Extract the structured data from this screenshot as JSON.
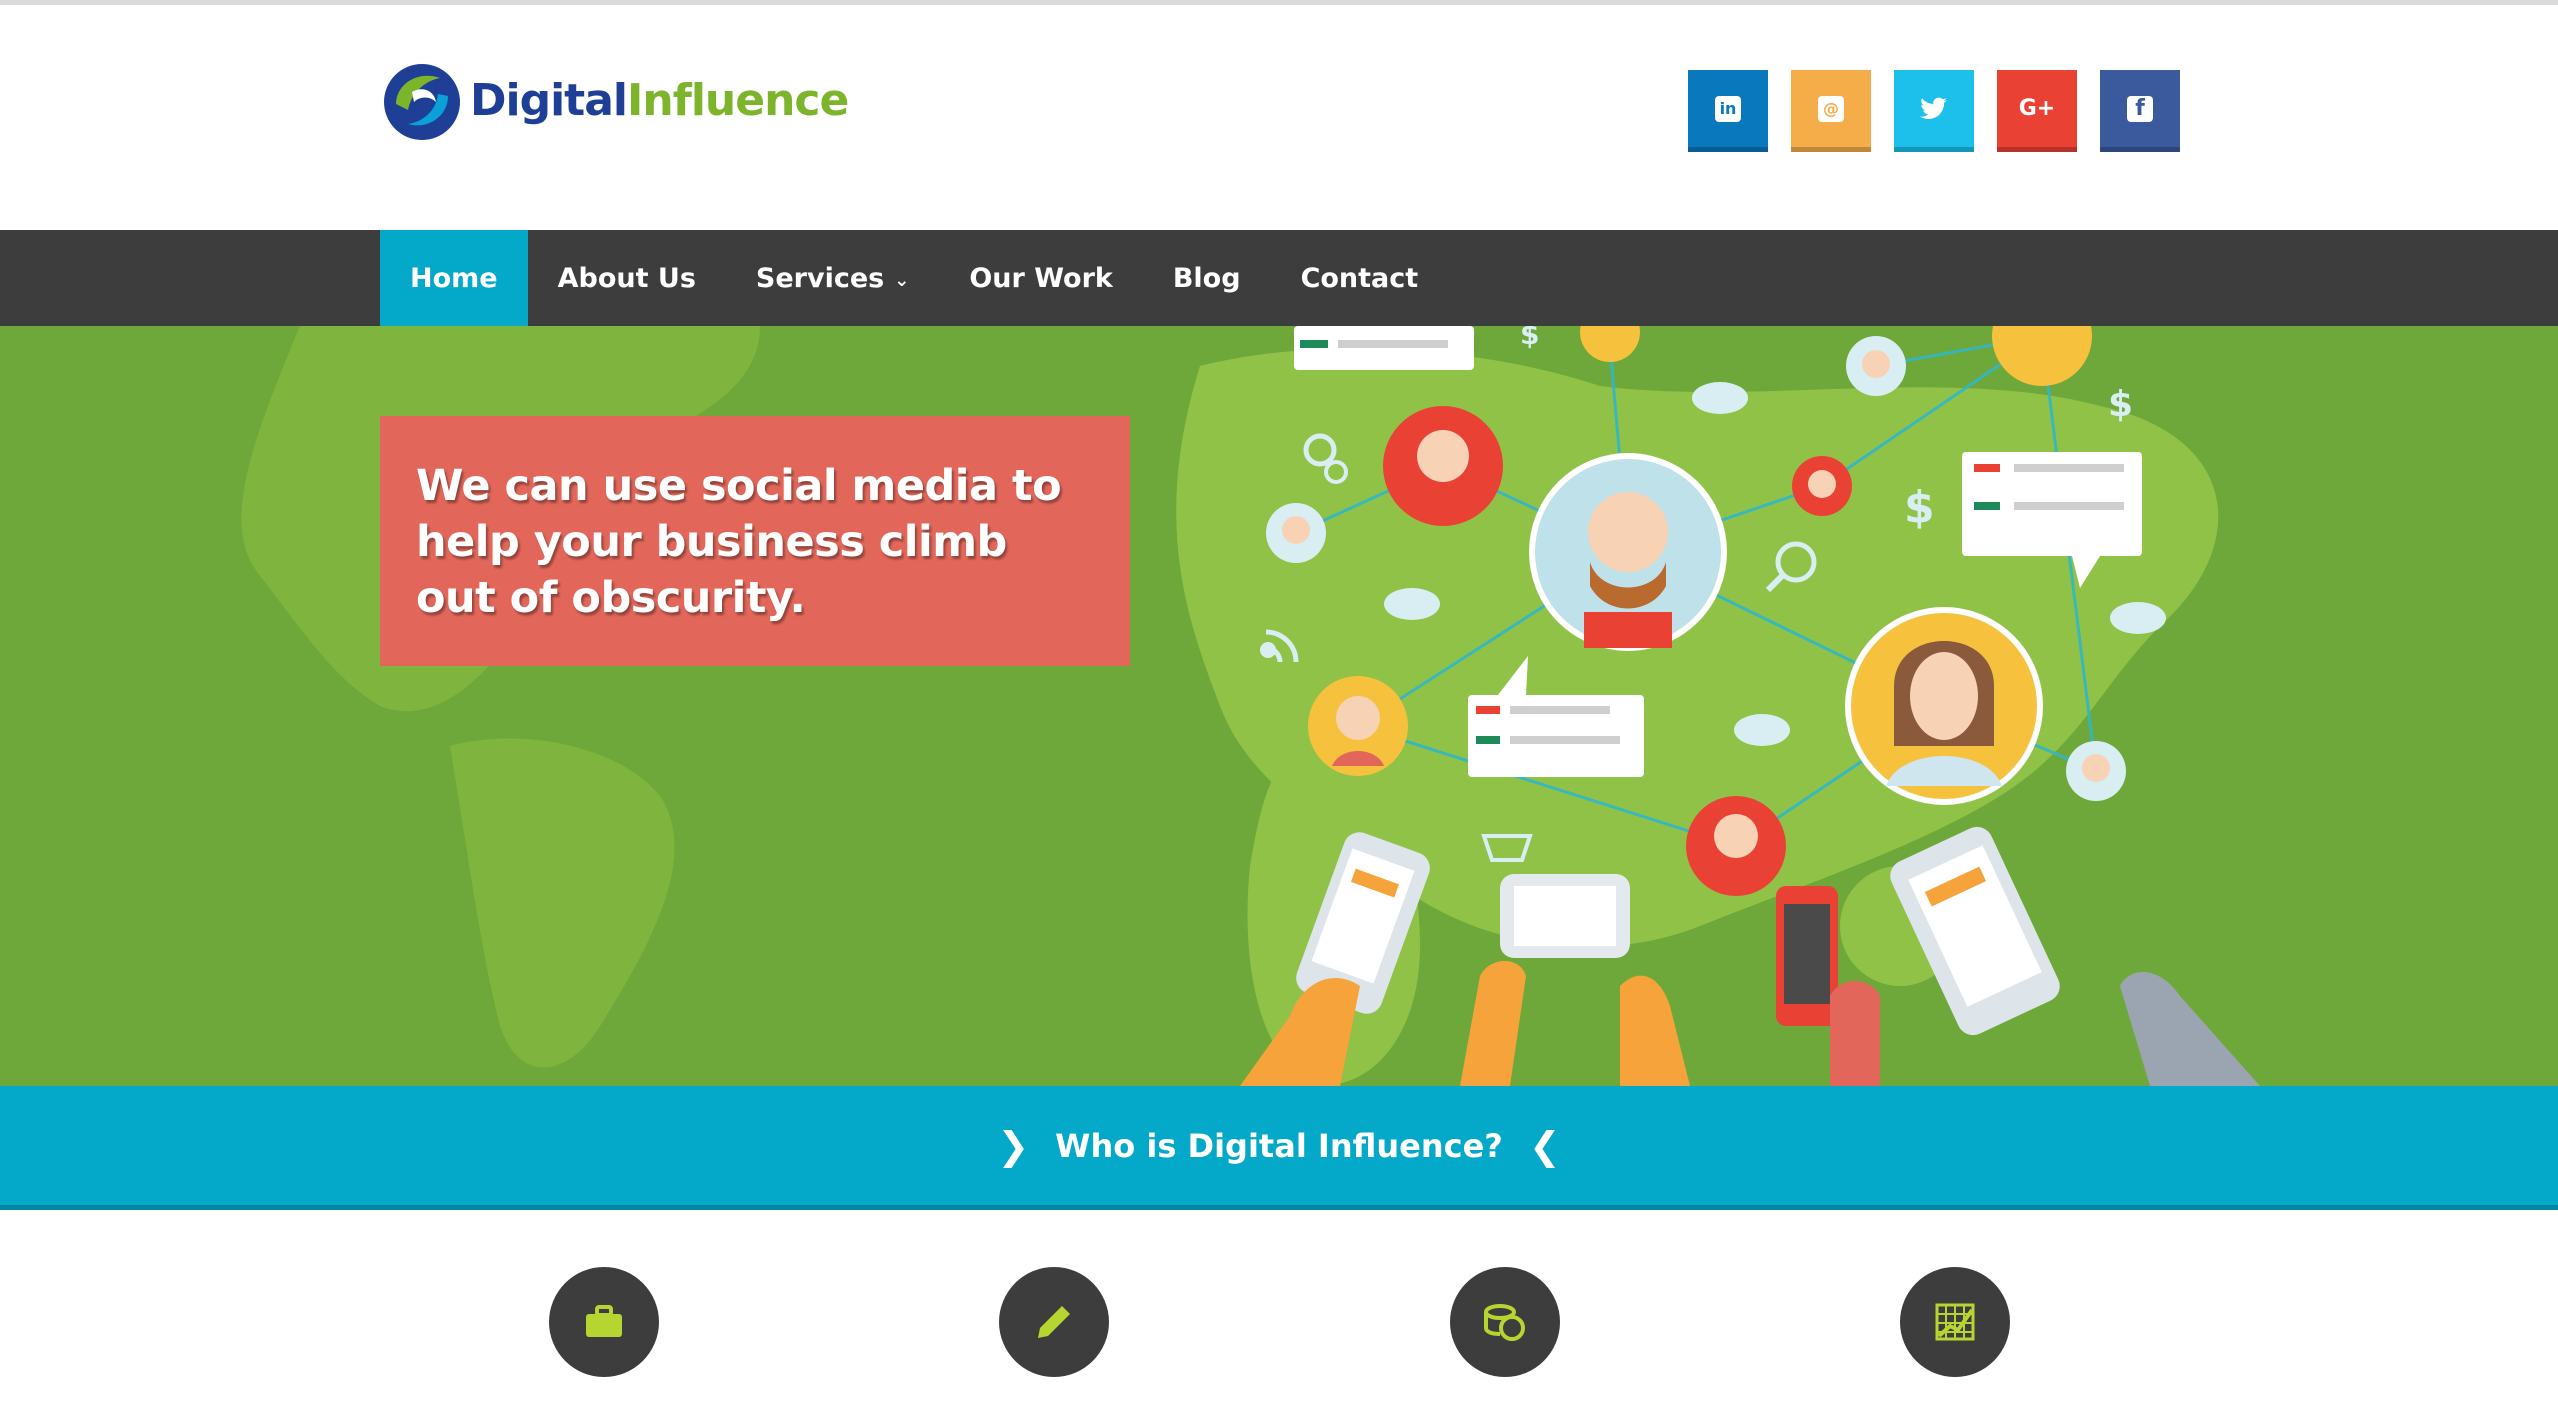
{
  "brand": {
    "name_part1": "Digital",
    "name_part2": "Influence"
  },
  "social": [
    {
      "name": "linkedin",
      "glyph": "in",
      "color": "#0a78bd"
    },
    {
      "name": "email",
      "glyph": "@",
      "color": "#f4ad49"
    },
    {
      "name": "twitter",
      "glyph": "🐦",
      "color": "#1dc0ea"
    },
    {
      "name": "googleplus",
      "glyph": "G+",
      "color": "#e94235"
    },
    {
      "name": "facebook",
      "glyph": "f",
      "color": "#3b5a9d"
    }
  ],
  "nav": {
    "items": [
      {
        "label": "Home",
        "active": true
      },
      {
        "label": "About Us"
      },
      {
        "label": "Services",
        "has_dropdown": true
      },
      {
        "label": "Our Work"
      },
      {
        "label": "Blog"
      },
      {
        "label": "Contact"
      }
    ]
  },
  "hero": {
    "headline": "We can use social media to help your business climb out of obscurity."
  },
  "band": {
    "text": "Who is Digital Influence?"
  },
  "services": [
    {
      "icon": "briefcase-icon"
    },
    {
      "icon": "pencil-icon"
    },
    {
      "icon": "coins-icon"
    },
    {
      "icon": "chart-icon"
    }
  ],
  "colors": {
    "nav_bg": "#3d3d3d",
    "accent": "#04a8c8",
    "hero_bg": "#6fa83a",
    "hero_box": "#e2675a",
    "icon_green": "#b6d531"
  }
}
